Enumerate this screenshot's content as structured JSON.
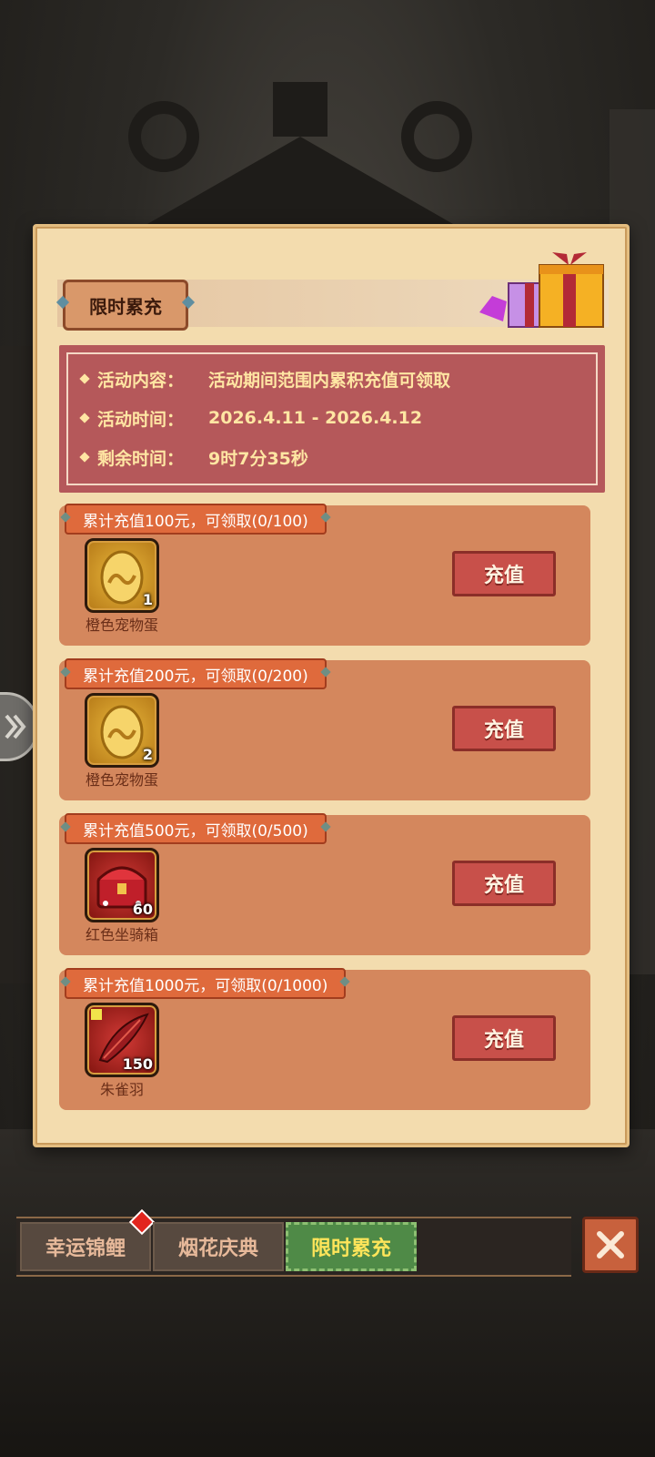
{
  "panel": {
    "title": "限时累充",
    "info": {
      "content_label": "活动内容：",
      "content_value": "活动期间范围内累积充值可领取",
      "time_label": "活动时间：",
      "time_value": "2026.4.11 - 2026.4.12",
      "remaining_label": "剩余时间：",
      "remaining_value": "9时7分35秒"
    },
    "rewards": [
      {
        "tag": "累计充值100元，可领取(0/100)",
        "item_name": "橙色宠物蛋",
        "item_count": "1",
        "button": "充值",
        "item_icon": "golden-egg-icon"
      },
      {
        "tag": "累计充值200元，可领取(0/200)",
        "item_name": "橙色宠物蛋",
        "item_count": "2",
        "button": "充值",
        "item_icon": "golden-egg-icon"
      },
      {
        "tag": "累计充值500元，可领取(0/500)",
        "item_name": "红色坐骑箱",
        "item_count": "60",
        "button": "充值",
        "item_icon": "red-chest-icon"
      },
      {
        "tag": "累计充值1000元，可领取(0/1000)",
        "item_name": "朱雀羽",
        "item_count": "150",
        "button": "充值",
        "item_icon": "red-feather-icon"
      }
    ]
  },
  "tabs": [
    {
      "label": "幸运锦鲤",
      "active": false,
      "badge": true
    },
    {
      "label": "烟花庆典",
      "active": false,
      "badge": false
    },
    {
      "label": "限时累充",
      "active": true,
      "badge": false
    }
  ],
  "colors": {
    "parchment": "#f3dcae",
    "info_box": "#b5585a",
    "reward_bg": "#d4875d",
    "tag_bg": "#df6a3c",
    "button": "#c8504a",
    "active_tab": "#4f8a47",
    "accent_text": "#ffe6a3"
  }
}
